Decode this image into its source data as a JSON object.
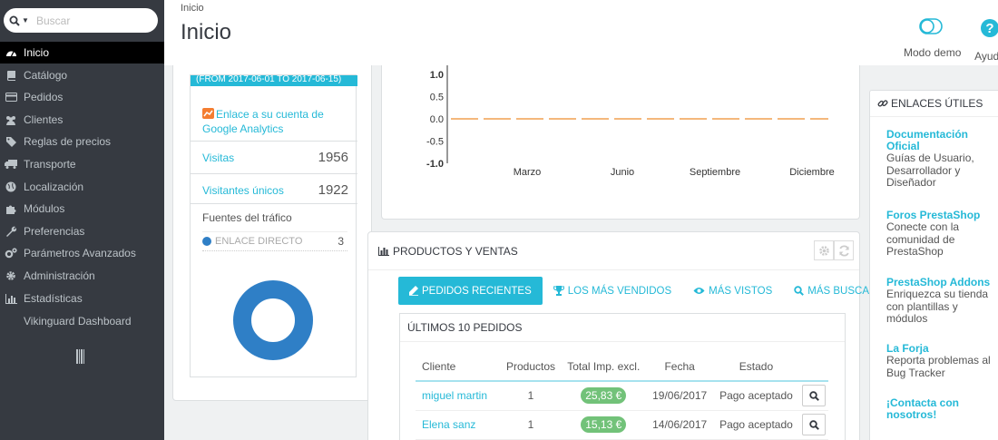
{
  "search": {
    "placeholder": "Buscar"
  },
  "sidebar": {
    "items": [
      {
        "label": "Inicio",
        "icon": "dashboard-icon"
      },
      {
        "label": "Catálogo",
        "icon": "book-icon"
      },
      {
        "label": "Pedidos",
        "icon": "credit-card-icon"
      },
      {
        "label": "Clientes",
        "icon": "users-icon"
      },
      {
        "label": "Reglas de precios",
        "icon": "tag-icon"
      },
      {
        "label": "Transporte",
        "icon": "truck-icon"
      },
      {
        "label": "Localización",
        "icon": "globe-icon"
      },
      {
        "label": "Módulos",
        "icon": "puzzle-icon"
      },
      {
        "label": "Preferencias",
        "icon": "wrench-icon"
      },
      {
        "label": "Parámetros Avanzados",
        "icon": "cogs-icon"
      },
      {
        "label": "Administración",
        "icon": "gear-icon"
      },
      {
        "label": "Estadísticas",
        "icon": "bar-chart-icon"
      },
      {
        "label": "Vikinguard Dashboard",
        "icon": ""
      }
    ]
  },
  "header": {
    "breadcrumb": "Inicio",
    "title": "Inicio",
    "demo_label": "Modo demo",
    "help_label": "Ayuda"
  },
  "analytics": {
    "banner": "(FROM 2017-06-01 TO 2017-06-15)",
    "link": "Enlace a su cuenta de Google Analytics",
    "visits_label": "Visitas",
    "visits_value": "1956",
    "unique_label": "Visitantes únicos",
    "unique_value": "1922",
    "traffic_title": "Fuentes del tráfico",
    "traffic_source": "ENLACE DIRECTO",
    "traffic_count": "3"
  },
  "chart_data": {
    "type": "line",
    "categories": [
      "Marzo",
      "Junio",
      "Septiembre",
      "Diciembre"
    ],
    "series": [
      {
        "values": [
          0,
          0,
          0,
          0
        ],
        "color": "#f0a050"
      }
    ],
    "yticks": [
      "1.0",
      "0.5",
      "0.0",
      "-0.5",
      "-1.0"
    ],
    "ylim": [
      -1.0,
      1.0
    ],
    "title": "",
    "xlabel": "",
    "ylabel": ""
  },
  "sales": {
    "title": "Productos y ventas",
    "tabs": [
      {
        "label": "Pedidos recientes"
      },
      {
        "label": "Los más vendidos"
      },
      {
        "label": "Más vistos"
      },
      {
        "label": "Más buscados"
      }
    ],
    "orders_title": "Últimos 10 pedidos",
    "columns": [
      "Cliente",
      "Productos",
      "Total Imp. excl.",
      "Fecha",
      "Estado"
    ],
    "rows": [
      {
        "client": "miguel martin",
        "products": "1",
        "total": "25,83 €",
        "date": "19/06/2017",
        "status": "Pago aceptado"
      },
      {
        "client": "Elena sanz",
        "products": "1",
        "total": "15,13 €",
        "date": "14/06/2017",
        "status": "Pago aceptado"
      }
    ]
  },
  "links": {
    "title": "Enlaces útiles",
    "items": [
      {
        "title": "Documentación Oficial",
        "desc": "Guías de Usuario, Desarrollador y Diseñador"
      },
      {
        "title": "Foros PrestaShop",
        "desc": "Conecte con la comunidad de PrestaShop"
      },
      {
        "title": "PrestaShop Addons",
        "desc": "Enriquezca su tienda con plantillas y módulos"
      },
      {
        "title": "La Forja",
        "desc": "Reporta problemas al Bug Tracker"
      },
      {
        "title": "¡Contacta con nosotros!",
        "desc": ""
      }
    ]
  },
  "colors": {
    "accent": "#25b9d7",
    "sidebar": "#363a41",
    "success": "#72c279"
  }
}
